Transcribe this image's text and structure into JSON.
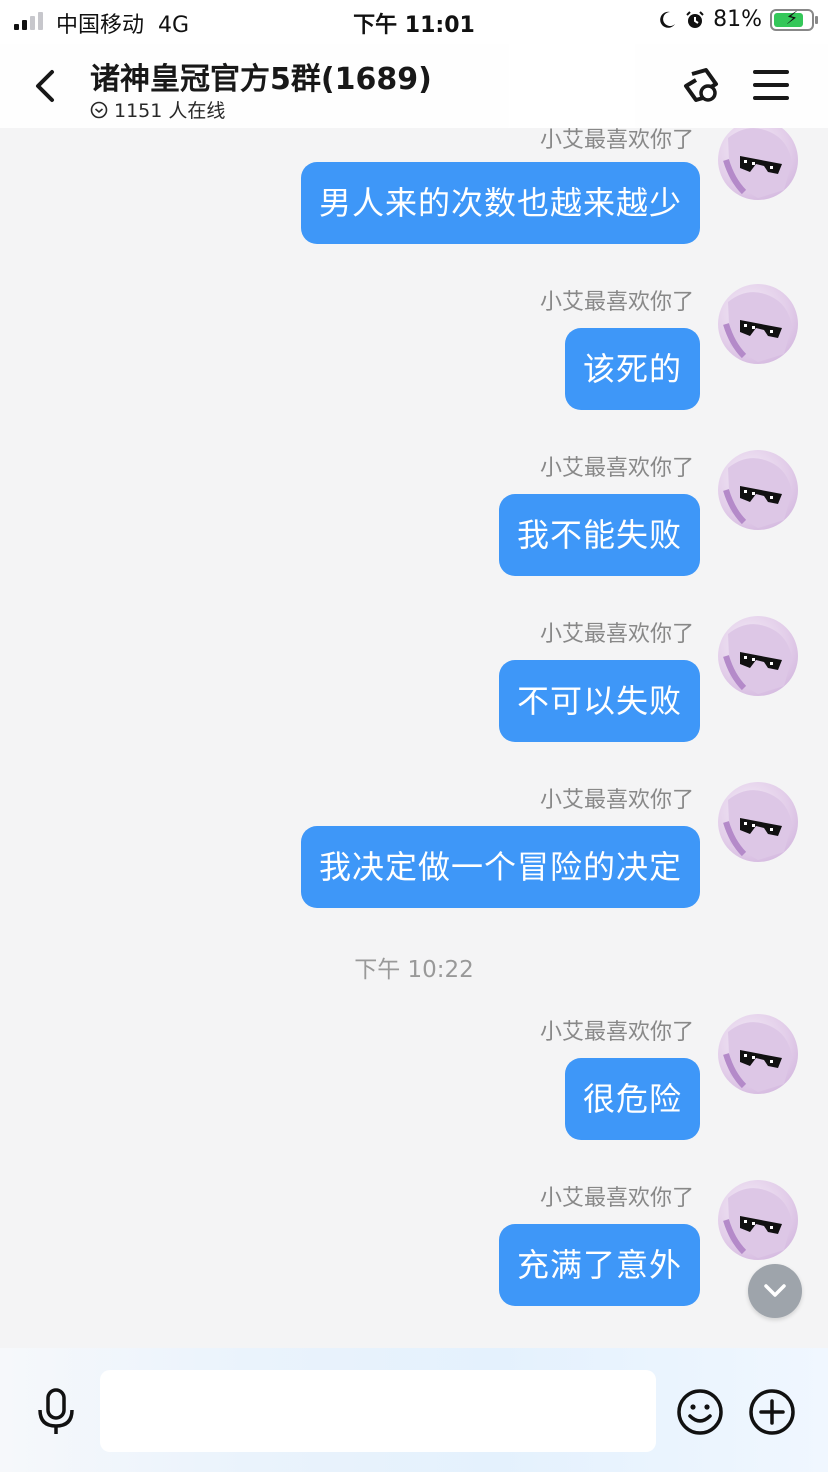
{
  "status_bar": {
    "carrier": "中国移动",
    "network": "4G",
    "time": "下午 11:01",
    "battery": "81%",
    "battery_level": 0.81
  },
  "header": {
    "title": "诸神皇冠官方5群(1689)",
    "online_count": "1151 人在线"
  },
  "messages": [
    {
      "sender": "小艾最喜欢你了",
      "text": "男人来的次数也越来越少"
    },
    {
      "sender": "小艾最喜欢你了",
      "text": "该死的"
    },
    {
      "sender": "小艾最喜欢你了",
      "text": "我不能失败"
    },
    {
      "sender": "小艾最喜欢你了",
      "text": "不可以失败"
    },
    {
      "sender": "小艾最喜欢你了",
      "text": "我决定做一个冒险的决定"
    },
    {
      "sender": "小艾最喜欢你了",
      "text": "很危险"
    },
    {
      "sender": "小艾最喜欢你了",
      "text": "充满了意外"
    }
  ],
  "timestamp": "下午 10:22",
  "input": {
    "placeholder": ""
  },
  "colors": {
    "bubble": "#3e97f8",
    "background": "#f4f4f5",
    "accent": "#3e97f8"
  },
  "icons": [
    "back-arrow-icon",
    "check-circle-icon",
    "group-link-icon",
    "menu-icon",
    "mic-icon",
    "emoji-icon",
    "plus-icon",
    "chevron-down-icon",
    "sunglasses-avatar-icon"
  ]
}
